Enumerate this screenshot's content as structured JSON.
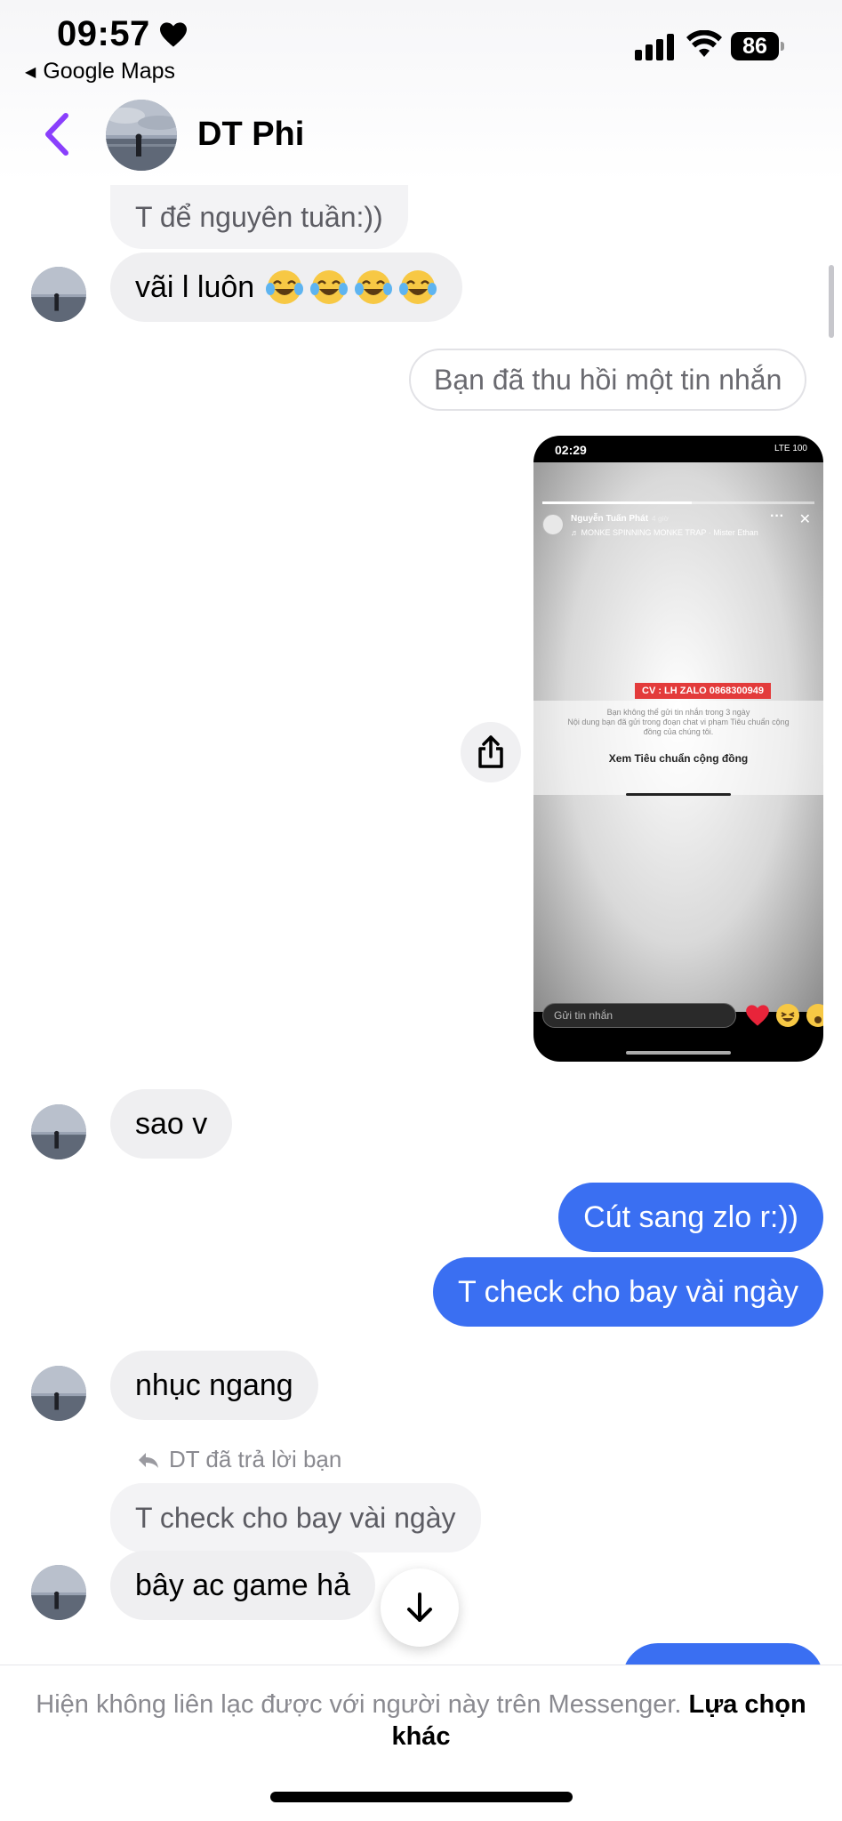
{
  "status_bar": {
    "time": "09:57",
    "back_app": "Google Maps",
    "battery": "86"
  },
  "header": {
    "contact_name": "DT Phi"
  },
  "messages": [
    {
      "type": "reply_ref_top",
      "text": "T để nguyên tuần:))"
    },
    {
      "type": "in",
      "text": "vãi l luôn"
    },
    {
      "type": "system",
      "text": "Bạn đã thu hồi một tin nhắn"
    },
    {
      "type": "in",
      "text": "sao v"
    },
    {
      "type": "out",
      "text": "Cút sang zlo r:))"
    },
    {
      "type": "out",
      "text": "T check cho bay vài ngày"
    },
    {
      "type": "in",
      "text": "nhục ngang"
    },
    {
      "type": "reply_label",
      "text": "DT đã trả lời bạn"
    },
    {
      "type": "reply_ref",
      "text": "T check cho bay vài ngày"
    },
    {
      "type": "in",
      "text": "bây ac game hả"
    }
  ],
  "shared_screenshot": {
    "time": "02:29",
    "status": "LTE 100",
    "user": "Nguyễn Tuấn Phát",
    "age": "4 giờ",
    "song": "♬ MONKE SPINNING MONKE TRAP · Mister Ethan",
    "red_label": "CV : LH ZALO 0868300949",
    "notice_1": "Bạn không thể gửi tin nhắn trong 3 ngày",
    "notice_2": "Nội dung bạn đã gửi trong đoạn chat vi phạm Tiêu chuẩn cộng",
    "notice_3": "đồng của chúng tôi.",
    "link": "Xem Tiêu chuẩn cộng đồng",
    "input_placeholder": "Gửi tin nhắn"
  },
  "footer": {
    "notice": "Hiện không liên lạc được với người này trên Messenger.",
    "action": "Lựa chọn khác"
  },
  "colors": {
    "outgoing": "#3a6ff2",
    "incoming": "#efeff1",
    "accent_back": "#8a3ffc"
  }
}
